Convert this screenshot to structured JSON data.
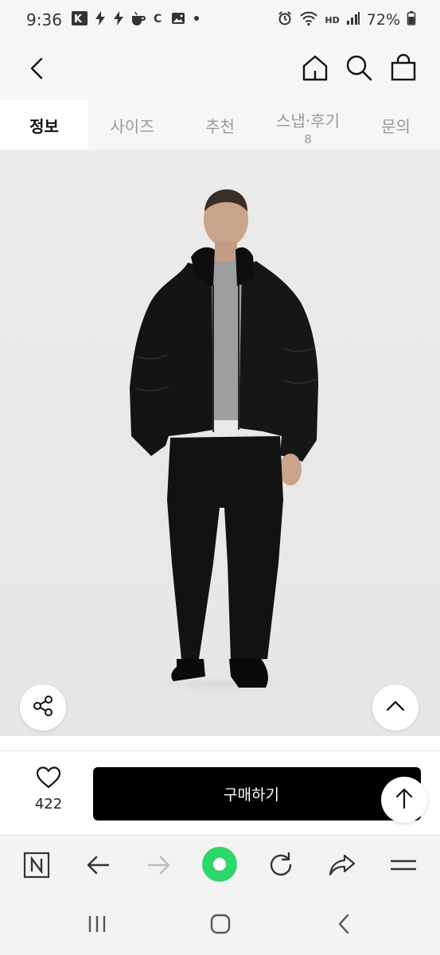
{
  "status_bar": {
    "time": "9:36",
    "hd_label": "HD",
    "battery": "72%",
    "icons": [
      "ks-app-icon",
      "bolt-icon",
      "bolt-icon",
      "coffee-icon",
      "c-app-icon",
      "gallery-icon",
      "dot-icon",
      "alarm-icon",
      "wifi-icon",
      "signal-icon",
      "battery-icon"
    ]
  },
  "header": {
    "back_icon": "chevron-left-icon",
    "home_icon": "home-icon",
    "search_icon": "search-icon",
    "cart_icon": "shopping-bag-icon"
  },
  "tabs": [
    {
      "label": "정보",
      "active": true
    },
    {
      "label": "사이즈",
      "active": false
    },
    {
      "label": "추천",
      "active": false
    },
    {
      "label": "스냅·후기",
      "count": "8",
      "active": false
    },
    {
      "label": "문의",
      "active": false
    }
  ],
  "product": {
    "image": "model-in-black-puffer-jacket-photo",
    "share_icon": "share-icon",
    "collapse_icon": "chevron-up-icon"
  },
  "purchase": {
    "like_icon": "heart-icon",
    "like_count": "422",
    "buy_label": "구매하기",
    "scroll_top_icon": "arrow-up-icon"
  },
  "browser_bar": {
    "icons": [
      "naver-icon",
      "back-arrow-icon",
      "forward-arrow-icon",
      "green-dot-icon",
      "refresh-icon",
      "share-arrow-icon",
      "menu-icon"
    ],
    "colors": {
      "green": "#2fd66b",
      "forward_disabled": "#bdbdbd"
    }
  },
  "nav_bar": {
    "icons": [
      "recent-apps-icon",
      "home-button-icon",
      "back-button-icon"
    ]
  },
  "colors": {
    "header_bg": "#f6f6f6",
    "buy_button": "#000000",
    "tab_inactive": "#999999"
  }
}
